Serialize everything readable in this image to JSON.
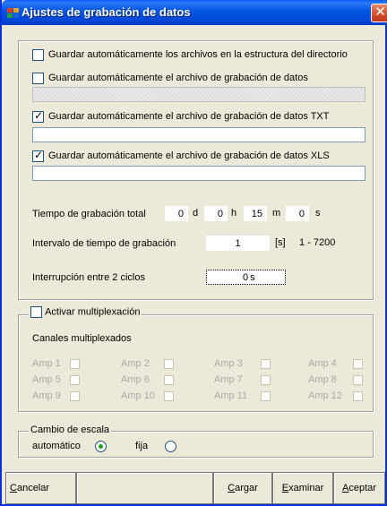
{
  "window": {
    "title": "Ajustes de grabación de datos",
    "close_symbol": "✕",
    "colors": {
      "titlebar": "#0054e3",
      "face": "#ece9d8",
      "close": "#d4512e"
    }
  },
  "save_options": [
    {
      "label": "Guardar automáticamente los archivos en la estructura del directorio",
      "checked": false
    },
    {
      "label": "Guardar automáticamente el archivo de grabación de datos",
      "checked": false,
      "path": ""
    },
    {
      "label": "Guardar automáticamente el archivo de grabación de datos TXT",
      "checked": true,
      "path": ""
    },
    {
      "label": "Guardar automáticamente el archivo de grabación de datos XLS",
      "checked": true,
      "path": ""
    }
  ],
  "total_time": {
    "label": "Tiempo de grabación total",
    "days": "0",
    "days_unit": "d",
    "hours": "0",
    "hours_unit": "h",
    "minutes": "15",
    "minutes_unit": "m",
    "seconds": "0",
    "seconds_unit": "s"
  },
  "interval": {
    "label": "Intervalo de tiempo de grabación",
    "value": "1",
    "unit": "[s]",
    "range": "1 - 7200"
  },
  "pause": {
    "label": "Interrupción entre 2 ciclos",
    "value": "0",
    "unit": "s"
  },
  "multiplex": {
    "legend": "Activar multiplexación",
    "checked": false,
    "channels_label": "Canales multiplexados",
    "channels": [
      "Amp 1",
      "Amp 2",
      "Amp 3",
      "Amp 4",
      "Amp 5",
      "Amp 6",
      "Amp 7",
      "Amp 8",
      "Amp 9",
      "Amp 10",
      "Amp 11",
      "Amp 12"
    ]
  },
  "scale": {
    "legend": "Cambio de escala",
    "automatic": "automático",
    "fixed": "fija",
    "selected": "automático"
  },
  "buttons": {
    "cancel": {
      "accel": "C",
      "rest": "ancelar"
    },
    "load": {
      "accel": "C",
      "rest": "argar"
    },
    "browse": {
      "accel": "E",
      "rest": "xaminar"
    },
    "accept": {
      "accel": "A",
      "rest": "ceptar"
    }
  },
  "icons": {
    "app": "app-icon",
    "close": "close-icon"
  }
}
